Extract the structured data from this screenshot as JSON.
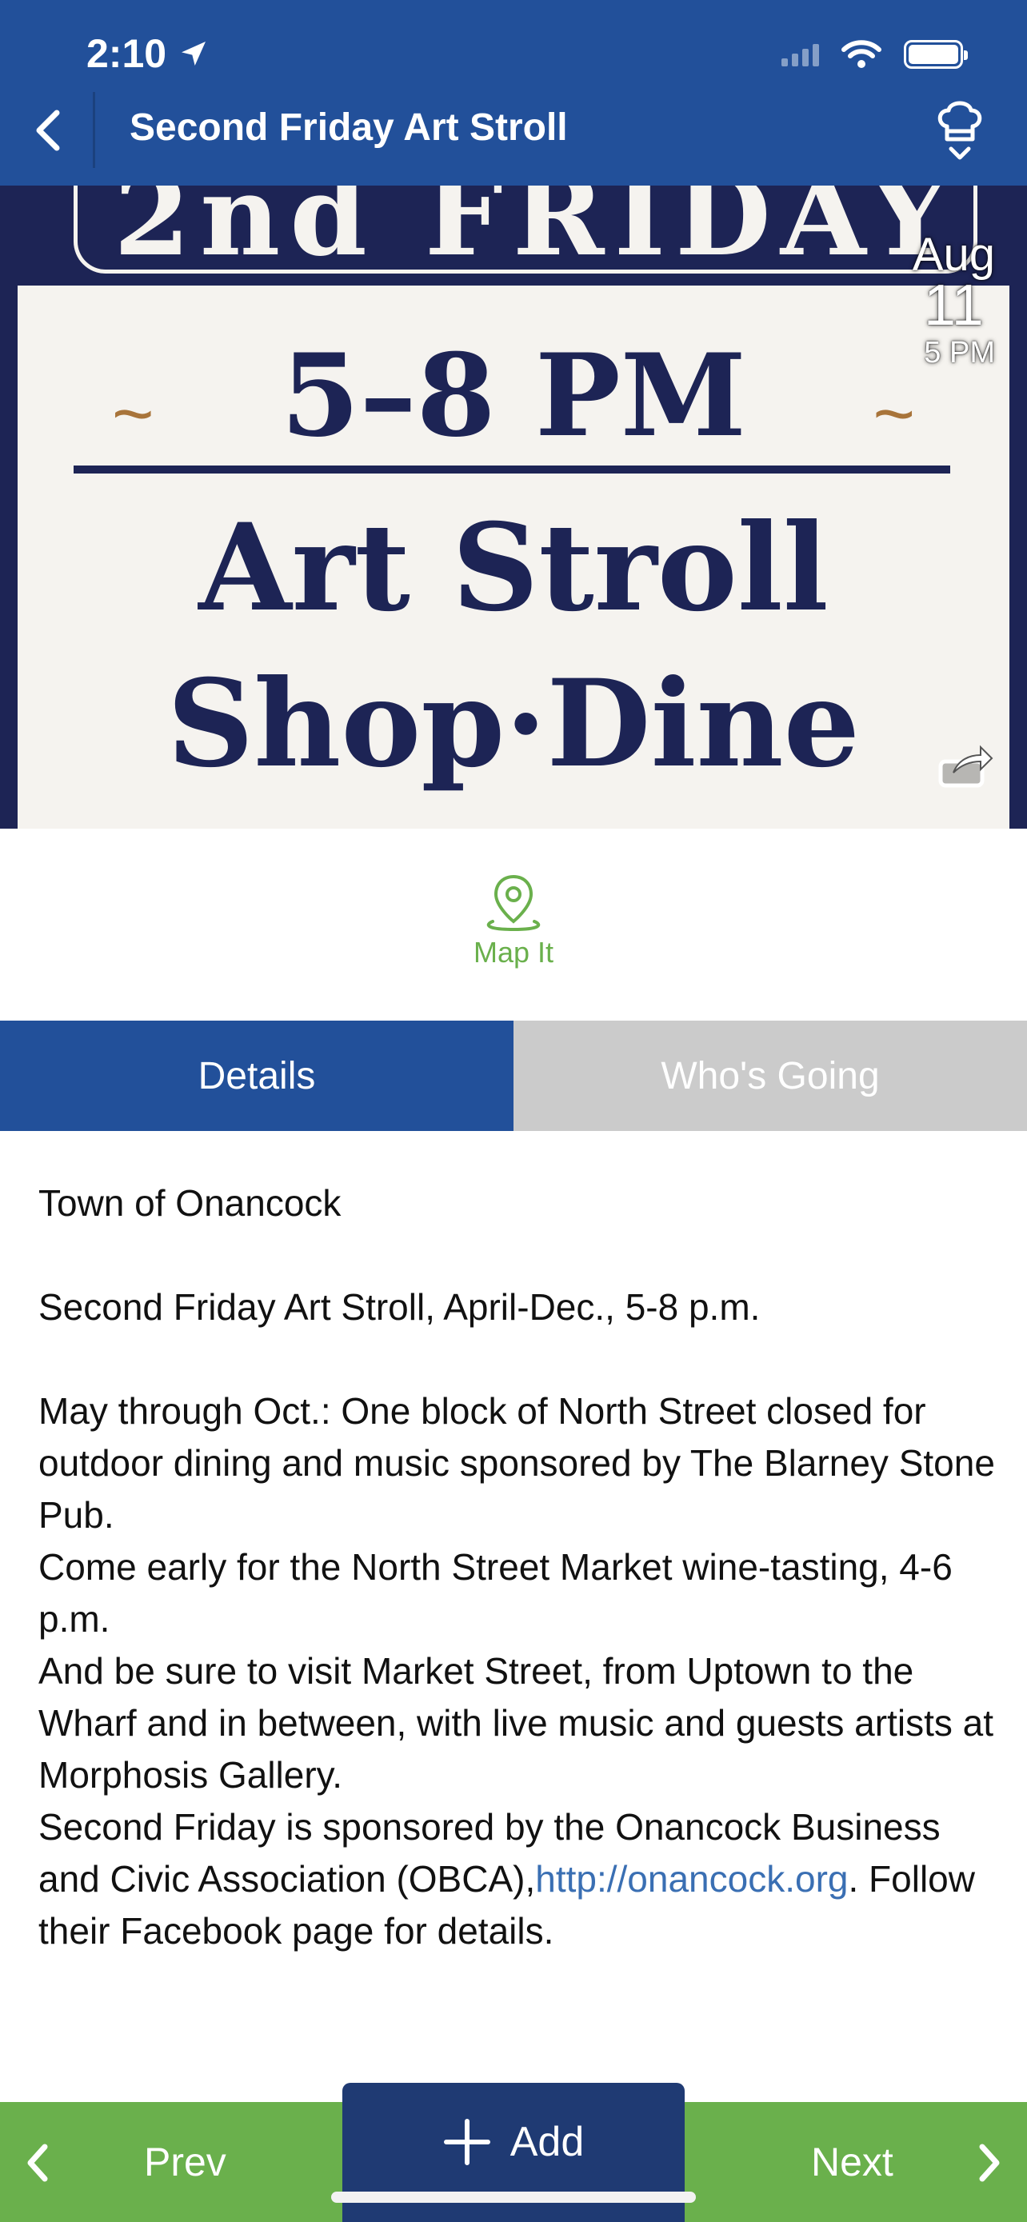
{
  "status_bar": {
    "time": "2:10"
  },
  "header": {
    "title": "Second Friday Art Stroll"
  },
  "hero": {
    "top_text": "2nd FRIDAY",
    "time_text": "5–8 PM",
    "line1": "Art Stroll",
    "line2": "Shop·Dine"
  },
  "date_badge": {
    "month": "Aug",
    "day": "11",
    "time": "5 PM"
  },
  "map": {
    "label": "Map It"
  },
  "tabs": [
    {
      "label": "Details"
    },
    {
      "label": "Who's Going"
    }
  ],
  "details": {
    "org": "Town of Onancock",
    "summary": "Second Friday Art Stroll, April-Dec., 5-8 p.m.",
    "p1": "May through Oct.: One block of North Street closed for outdoor dining and music sponsored by The Blarney Stone Pub.",
    "p2": "Come early for the North Street Market wine-tasting, 4-6 p.m.",
    "p3": "And be sure to visit Market Street, from Uptown to the Wharf and in between, with live music and guests artists at Morphosis Gallery.",
    "p4_before": "Second Friday is sponsored by the Onancock Business and Civic Association (OBCA),",
    "p4_link": "http://onancock.org",
    "p4_after": ". Follow their Facebook page for details."
  },
  "bottom_bar": {
    "prev": "Prev",
    "add": "Add",
    "next": "Next"
  },
  "colors": {
    "header": "#22509a",
    "accent_green": "#6ab04c",
    "add_button": "#1f3a73",
    "link": "#3a6fb3"
  }
}
